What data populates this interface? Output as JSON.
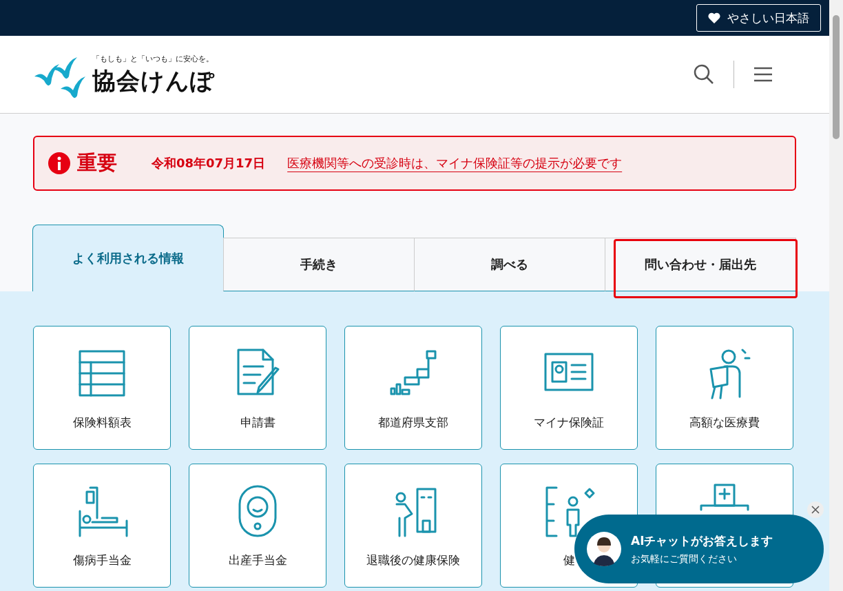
{
  "topbar": {
    "easy_japanese": "やさしい日本語"
  },
  "header": {
    "tagline": "「もしも」と「いつも」に安心を。",
    "logo_text": "協会けんぽ"
  },
  "notice": {
    "label": "重要",
    "date": "令和08年07月17日",
    "link": "医療機関等への受診時は、マイナ保険証等の提示が必要です"
  },
  "tabs": [
    {
      "label": "よく利用される情報",
      "selected": true,
      "highlighted": false
    },
    {
      "label": "手続き",
      "selected": false,
      "highlighted": false
    },
    {
      "label": "調べる",
      "selected": false,
      "highlighted": false
    },
    {
      "label": "問い合わせ・届出先",
      "selected": false,
      "highlighted": true
    }
  ],
  "cards": [
    {
      "kind": "table",
      "label": "保険料額表"
    },
    {
      "kind": "form",
      "label": "申請書"
    },
    {
      "kind": "map",
      "label": "都道府県支部"
    },
    {
      "kind": "idcard",
      "label": "マイナ保険証"
    },
    {
      "kind": "person",
      "label": "高額な医療費"
    },
    {
      "kind": "bed",
      "label": "傷病手当金"
    },
    {
      "kind": "baby",
      "label": "出産手当金"
    },
    {
      "kind": "retire",
      "label": "退職後の健康保険"
    },
    {
      "kind": "checkup",
      "label": "健"
    },
    {
      "kind": "hospital"
    }
  ],
  "chat": {
    "title": "AIチャットがお答えします",
    "subtitle": "お気軽にご質問ください"
  }
}
